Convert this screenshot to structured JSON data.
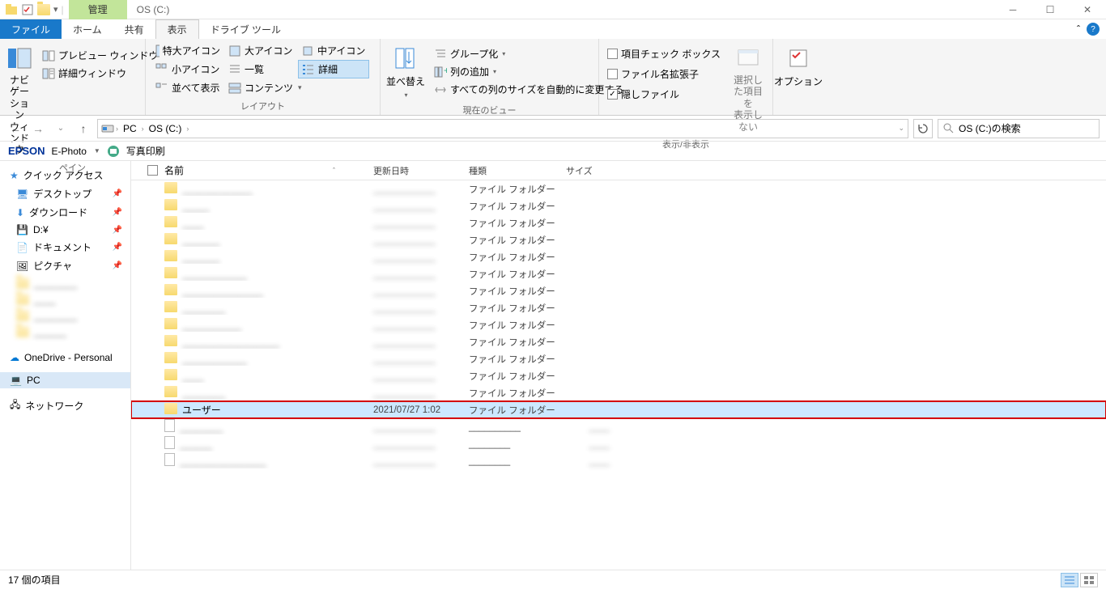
{
  "window": {
    "contextual_tab": "管理",
    "title": "OS (C:)"
  },
  "tabs": {
    "file": "ファイル",
    "home": "ホーム",
    "share": "共有",
    "view": "表示",
    "drive_tools": "ドライブ ツール"
  },
  "ribbon": {
    "pane_group": "ペイン",
    "nav_pane": "ナビゲーション\nウィンドウ",
    "preview_pane": "プレビュー ウィンドウ",
    "details_pane": "詳細ウィンドウ",
    "layout_group": "レイアウト",
    "xl_icons": "特大アイコン",
    "l_icons": "大アイコン",
    "m_icons": "中アイコン",
    "s_icons": "小アイコン",
    "list": "一覧",
    "details": "詳細",
    "tiles": "並べて表示",
    "content": "コンテンツ",
    "sort": "並べ替え",
    "group_by": "グループ化",
    "add_columns": "列の追加",
    "size_all": "すべての列のサイズを自動的に変更する",
    "current_view_group": "現在のビュー",
    "item_check": "項目チェック ボックス",
    "file_ext": "ファイル名拡張子",
    "hidden": "隠しファイル",
    "hide_selected": "選択した項目を\n表示しない",
    "show_hide_group": "表示/非表示",
    "options": "オプション"
  },
  "breadcrumb": {
    "pc": "PC",
    "drive": "OS (C:)"
  },
  "search": {
    "placeholder": "OS (C:)の検索"
  },
  "epson": {
    "brand": "EPSON",
    "product": "E-Photo",
    "print": "写真印刷"
  },
  "columns": {
    "name": "名前",
    "date": "更新日時",
    "type": "種類",
    "size": "サイズ"
  },
  "sidebar": {
    "quick": "クイック アクセス",
    "desktop": "デスクトップ",
    "downloads": "ダウンロード",
    "d_drive": "D:¥",
    "documents": "ドキュメント",
    "pictures": "ピクチャ",
    "onedrive": "OneDrive - Personal",
    "pc": "PC",
    "network": "ネットワーク"
  },
  "rows": [
    {
      "name": "_____________",
      "date": "____________",
      "type": "ファイル フォルダー",
      "size": "",
      "icon": "folder",
      "blur": true
    },
    {
      "name": "_____",
      "date": "____________",
      "type": "ファイル フォルダー",
      "size": "",
      "icon": "folder",
      "blur": true
    },
    {
      "name": "____",
      "date": "____________",
      "type": "ファイル フォルダー",
      "size": "",
      "icon": "folder",
      "blur": true
    },
    {
      "name": "_______",
      "date": "____________",
      "type": "ファイル フォルダー",
      "size": "",
      "icon": "folder",
      "blur": true
    },
    {
      "name": "_______",
      "date": "____________",
      "type": "ファイル フォルダー",
      "size": "",
      "icon": "folder",
      "blur": true
    },
    {
      "name": "____________",
      "date": "____________",
      "type": "ファイル フォルダー",
      "size": "",
      "icon": "folder",
      "blur": true
    },
    {
      "name": "_______________",
      "date": "____________",
      "type": "ファイル フォルダー",
      "size": "",
      "icon": "folder",
      "blur": true
    },
    {
      "name": "________",
      "date": "____________",
      "type": "ファイル フォルダー",
      "size": "",
      "icon": "folder",
      "blur": true
    },
    {
      "name": "___________",
      "date": "____________",
      "type": "ファイル フォルダー",
      "size": "",
      "icon": "folder",
      "blur": true
    },
    {
      "name": "__________________",
      "date": "____________",
      "type": "ファイル フォルダー",
      "size": "",
      "icon": "folder",
      "blur": true
    },
    {
      "name": "____________",
      "date": "____________",
      "type": "ファイル フォルダー",
      "size": "",
      "icon": "folder",
      "blur": true
    },
    {
      "name": "____",
      "date": "____________",
      "type": "ファイル フォルダー",
      "size": "",
      "icon": "folder",
      "blur": true
    },
    {
      "name": "________",
      "date": "____________",
      "type": "ファイル フォルダー",
      "size": "",
      "icon": "folder",
      "blur": true
    },
    {
      "name": "ユーザー",
      "date": "2021/07/27 1:02",
      "type": "ファイル フォルダー",
      "size": "",
      "icon": "folder",
      "highlight": true
    },
    {
      "name": "________",
      "date": "____________",
      "type": "__________",
      "size": "____",
      "icon": "file",
      "blur": true
    },
    {
      "name": "______",
      "date": "____________",
      "type": "________",
      "size": "____",
      "icon": "file",
      "blur": true
    },
    {
      "name": "________________",
      "date": "____________",
      "type": "________",
      "size": "____",
      "icon": "file",
      "blur": true
    }
  ],
  "status": {
    "count": "17 個の項目"
  }
}
